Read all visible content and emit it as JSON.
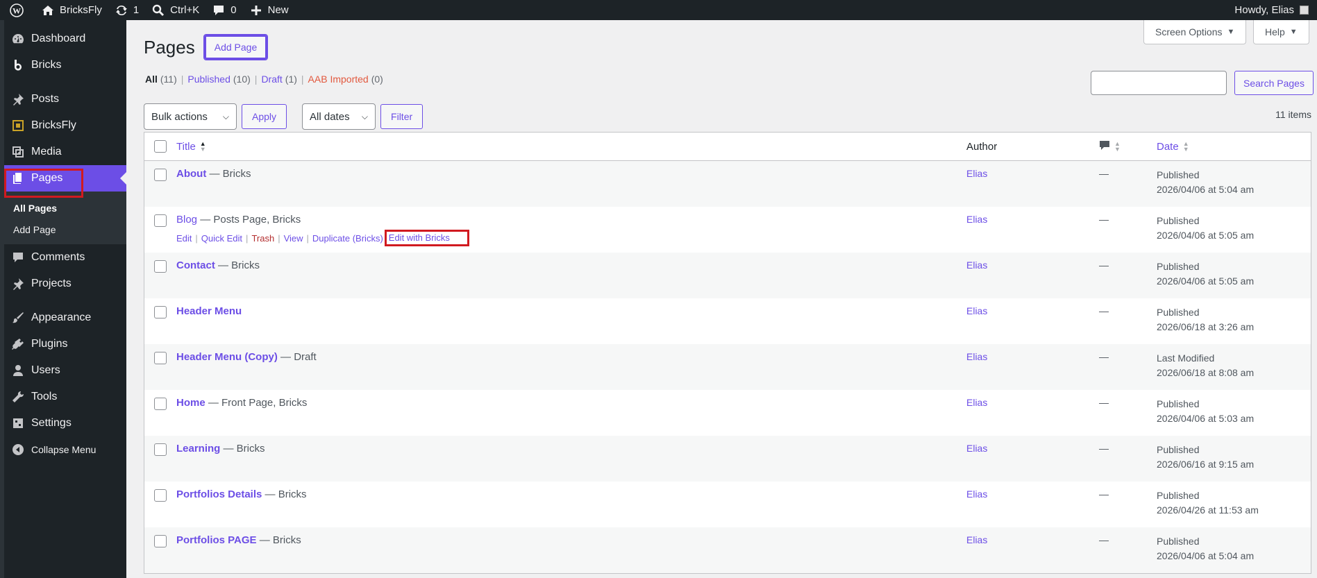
{
  "adminbar": {
    "site_name": "BricksFly",
    "updates_count": "1",
    "search_shortcut": "Ctrl+K",
    "comments_count": "0",
    "new_label": "New",
    "howdy": "Howdy, Elias"
  },
  "sidebar": {
    "items": [
      {
        "label": "Dashboard",
        "icon": "dashboard-icon"
      },
      {
        "label": "Bricks",
        "icon": "bricks-icon"
      },
      {
        "label": "Posts",
        "icon": "pin-icon"
      },
      {
        "label": "BricksFly",
        "icon": "bricksfly-icon"
      },
      {
        "label": "Media",
        "icon": "media-icon"
      },
      {
        "label": "Pages",
        "icon": "pages-icon"
      },
      {
        "label": "Comments",
        "icon": "comment-icon"
      },
      {
        "label": "Projects",
        "icon": "pin-icon"
      },
      {
        "label": "Appearance",
        "icon": "brush-icon"
      },
      {
        "label": "Plugins",
        "icon": "plugin-icon"
      },
      {
        "label": "Users",
        "icon": "user-icon"
      },
      {
        "label": "Tools",
        "icon": "wrench-icon"
      },
      {
        "label": "Settings",
        "icon": "settings-icon"
      },
      {
        "label": "Collapse Menu",
        "icon": "collapse-icon"
      }
    ],
    "submenu": [
      "All Pages",
      "Add Page"
    ]
  },
  "header": {
    "title": "Pages",
    "add_page": "Add Page",
    "screen_options": "Screen Options",
    "help": "Help"
  },
  "filters": {
    "all": "All",
    "all_count": "(11)",
    "published": "Published",
    "published_count": "(10)",
    "draft": "Draft",
    "draft_count": "(1)",
    "aab": "AAB Imported",
    "aab_count": "(0)"
  },
  "search": {
    "button": "Search Pages",
    "value": ""
  },
  "tablenav": {
    "bulk_actions": "Bulk actions",
    "apply": "Apply",
    "all_dates": "All dates",
    "filter": "Filter",
    "items_count": "11 items"
  },
  "table": {
    "headers": {
      "title": "Title",
      "author": "Author",
      "date": "Date"
    },
    "row_actions": [
      "Edit",
      "Quick Edit",
      "Trash",
      "View",
      "Duplicate (Bricks)",
      "Edit with Bricks"
    ],
    "rows": [
      {
        "title": "About",
        "state": " — Bricks",
        "author": "Elias",
        "comments": "—",
        "status": "Published",
        "date": "2026/04/06 at 5:04 am"
      },
      {
        "title": "Blog",
        "state": " — Posts Page, Bricks",
        "author": "Elias",
        "comments": "—",
        "status": "Published",
        "date": "2026/04/06 at 5:05 am"
      },
      {
        "title": "Contact",
        "state": " — Bricks",
        "author": "Elias",
        "comments": "—",
        "status": "Published",
        "date": "2026/04/06 at 5:05 am"
      },
      {
        "title": "Header Menu",
        "state": "",
        "author": "Elias",
        "comments": "—",
        "status": "Published",
        "date": "2026/06/18 at 3:26 am"
      },
      {
        "title": "Header Menu (Copy)",
        "state": " — Draft",
        "author": "Elias",
        "comments": "—",
        "status": "Last Modified",
        "date": "2026/06/18 at 8:08 am"
      },
      {
        "title": "Home",
        "state": " — Front Page, Bricks",
        "author": "Elias",
        "comments": "—",
        "status": "Published",
        "date": "2026/04/06 at 5:03 am"
      },
      {
        "title": "Learning",
        "state": " — Bricks",
        "author": "Elias",
        "comments": "—",
        "status": "Published",
        "date": "2026/06/16 at 9:15 am"
      },
      {
        "title": "Portfolios Details",
        "state": " — Bricks",
        "author": "Elias",
        "comments": "—",
        "status": "Published",
        "date": "2026/04/26 at 11:53 am"
      },
      {
        "title": "Portfolios PAGE",
        "state": " — Bricks",
        "author": "Elias",
        "comments": "—",
        "status": "Published",
        "date": "2026/04/06 at 5:04 am"
      }
    ]
  },
  "colors": {
    "accent": "#6c4ee6",
    "adminbar": "#1d2327",
    "highlight": "#d11a20",
    "aab": "#e2583e"
  }
}
